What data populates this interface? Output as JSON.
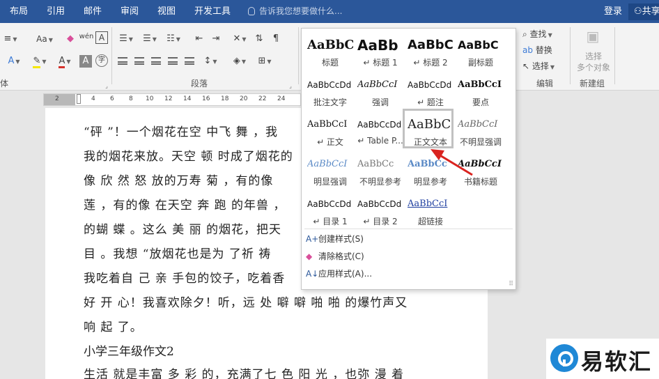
{
  "menubar": {
    "tabs": [
      "布局",
      "引用",
      "邮件",
      "审阅",
      "视图",
      "开发工具"
    ],
    "tell_me": "告诉我您想要做什么...",
    "login": "登录",
    "share": "共享"
  },
  "ribbon": {
    "font_group_tail": "体",
    "paragraph_label": "段落",
    "find": "查找",
    "replace": "替换",
    "select": "选择",
    "editing_label": "编辑",
    "select_objects_line1": "选择",
    "select_objects_line2": "多个对象",
    "new_group_label": "新建组",
    "aa_button": "Aa",
    "wen_char": "wén",
    "a_box": "A",
    "zi_char": "字"
  },
  "ruler": {
    "ticks": [
      "2",
      "2",
      "4",
      "6",
      "8",
      "10",
      "12",
      "14",
      "16",
      "18",
      "20",
      "22",
      "24"
    ]
  },
  "document": {
    "lines": [
      "“砰 ”！一个烟花在空 中飞 舞 ，我",
      "我的烟花来放。天空 顿 时成了烟花的",
      "像 欣 然 怒 放的万寿 菊 ，有的像",
      "莲 ，有的像 在天空 奔 跑 的年兽 ，",
      "的蝴 蝶 。这么 美 丽 的烟花，把天",
      "目 。我想 “放烟花也是为 了祈 祷",
      "我吃着自 己 亲 手包的饺子，吃着香",
      "好 开 心！我喜欢除夕！听，远 处 噼 噼 啪 啪 的爆竹声又",
      "响 起 了。",
      "小学三年级作文2",
      "生活 就是丰富 多 彩 的，充满了七 色 阳 光 ，也弥 漫 着"
    ]
  },
  "gallery": {
    "styles": [
      {
        "sample": "AaBbC",
        "name": "标题"
      },
      {
        "sample": "AaBb",
        "name": "↵ 标题 1"
      },
      {
        "sample": "AaBbC",
        "name": "↵ 标题 2"
      },
      {
        "sample": "AaBbC",
        "name": "副标题"
      },
      {
        "sample": "AaBbCcDd",
        "name": "批注文字"
      },
      {
        "sample": "AaBbCcI",
        "name": "强调"
      },
      {
        "sample": "AaBbCcDd",
        "name": "↵ 题注"
      },
      {
        "sample": "AaBbCcI",
        "name": "要点"
      },
      {
        "sample": "AaBbCcI",
        "name": "↵ 正文"
      },
      {
        "sample": "AaBbCcDd",
        "name": "↵ Table P..."
      },
      {
        "sample": "AaBbC",
        "name": "正文文本"
      },
      {
        "sample": "AaBbCcI",
        "name": "不明显强调"
      },
      {
        "sample": "AaBbCcI",
        "name": "明显强调"
      },
      {
        "sample": "AaBbCc",
        "name": "不明显参考"
      },
      {
        "sample": "AaBbCc",
        "name": "明显参考"
      },
      {
        "sample": "AaBbCcI",
        "name": "书籍标题"
      },
      {
        "sample": "AaBbCcDd",
        "name": "↵ 目录 1"
      },
      {
        "sample": "AaBbCcDd",
        "name": "↵ 目录 2"
      },
      {
        "sample": "AaBbCcI",
        "name": "超链接"
      }
    ],
    "commands": [
      "创建样式(S)",
      "清除格式(C)",
      "应用样式(A)..."
    ]
  },
  "watermark": {
    "text": "易软汇"
  },
  "colors": {
    "menubar": "#2b579a",
    "arrow": "#d9231f",
    "logo_blue": "#1f88d6"
  }
}
